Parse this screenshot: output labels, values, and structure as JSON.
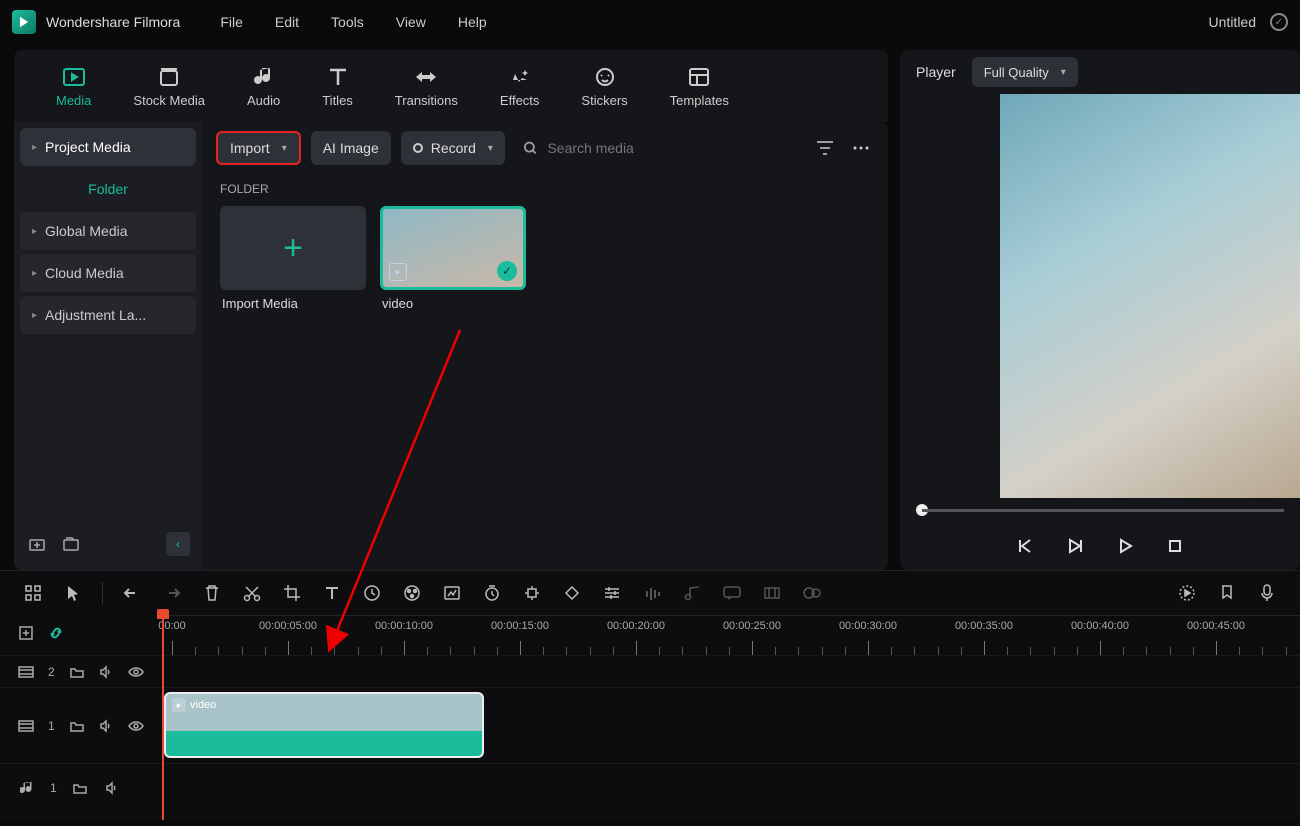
{
  "app": {
    "name": "Wondershare Filmora",
    "document": "Untitled"
  },
  "menubar": [
    "File",
    "Edit",
    "Tools",
    "View",
    "Help"
  ],
  "tabs": [
    {
      "id": "media",
      "label": "Media",
      "active": true
    },
    {
      "id": "stock",
      "label": "Stock Media"
    },
    {
      "id": "audio",
      "label": "Audio"
    },
    {
      "id": "titles",
      "label": "Titles"
    },
    {
      "id": "transitions",
      "label": "Transitions"
    },
    {
      "id": "effects",
      "label": "Effects"
    },
    {
      "id": "stickers",
      "label": "Stickers"
    },
    {
      "id": "templates",
      "label": "Templates"
    }
  ],
  "sidebar": {
    "items": [
      {
        "label": "Project Media",
        "sel": true,
        "caret": true
      },
      {
        "label": "Folder",
        "green": true
      },
      {
        "label": "Global Media",
        "caret": true
      },
      {
        "label": "Cloud Media",
        "caret": true
      },
      {
        "label": "Adjustment La...",
        "caret": true
      }
    ]
  },
  "toolbar": {
    "import": "Import",
    "ai_image": "AI Image",
    "record": "Record",
    "search_placeholder": "Search media"
  },
  "media": {
    "section_label": "FOLDER",
    "import_label": "Import Media",
    "clip_name": "video"
  },
  "player": {
    "label": "Player",
    "quality": "Full Quality"
  },
  "timeline": {
    "ticks": [
      "00:00",
      "00:00:05:00",
      "00:00:10:00",
      "00:00:15:00",
      "00:00:20:00",
      "00:00:25:00",
      "00:00:30:00",
      "00:00:35:00",
      "00:00:40:00",
      "00:00:45:00"
    ],
    "tracks": {
      "video2": "2",
      "video1": "1",
      "audio1": "1"
    },
    "clip_label": "video"
  }
}
